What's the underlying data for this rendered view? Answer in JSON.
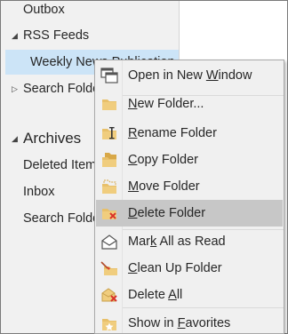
{
  "folder_pane": {
    "items": [
      {
        "label": "Outbox"
      },
      {
        "label": "RSS Feeds"
      },
      {
        "label": "Weekly News Publication"
      },
      {
        "label": "Search Folders"
      }
    ],
    "archives": {
      "title": "Archives",
      "items": [
        {
          "label": "Deleted Items"
        },
        {
          "label": "Inbox"
        },
        {
          "label": "Search Folders"
        }
      ]
    }
  },
  "context_menu": {
    "items": [
      {
        "icon": "open-new-window-icon",
        "pre": "Open in New ",
        "key": "W",
        "post": "indow"
      },
      {
        "icon": "new-folder-icon",
        "pre": "",
        "key": "N",
        "post": "ew Folder..."
      },
      {
        "icon": "rename-folder-icon",
        "pre": "",
        "key": "R",
        "post": "ename Folder"
      },
      {
        "icon": "copy-folder-icon",
        "pre": "",
        "key": "C",
        "post": "opy Folder"
      },
      {
        "icon": "move-folder-icon",
        "pre": "",
        "key": "M",
        "post": "ove Folder"
      },
      {
        "icon": "delete-folder-icon",
        "pre": "",
        "key": "D",
        "post": "elete Folder"
      },
      {
        "icon": "mark-all-read-icon",
        "pre": "Mar",
        "key": "k",
        "post": " All as Read"
      },
      {
        "icon": "clean-up-folder-icon",
        "pre": "",
        "key": "C",
        "post": "lean Up Folder"
      },
      {
        "icon": "delete-all-icon",
        "pre": "Delete ",
        "key": "A",
        "post": "ll"
      },
      {
        "icon": "show-in-favorites-icon",
        "pre": "Show in ",
        "key": "F",
        "post": "avorites"
      }
    ],
    "highlighted_index": 5
  },
  "colors": {
    "folder_yellow": "#e8c06a",
    "folder_yellow_dark": "#d8a848",
    "delete_red": "#d9312a",
    "selection_blue": "#cce4f7",
    "menu_highlight": "#c7c7c7"
  }
}
